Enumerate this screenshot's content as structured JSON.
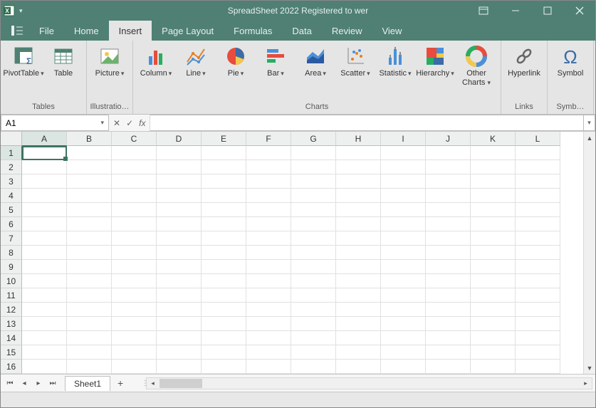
{
  "titlebar": {
    "app_title": "SpreadSheet 2022  Registered to wer"
  },
  "menu": {
    "tabs": [
      "File",
      "Home",
      "Insert",
      "Page Layout",
      "Formulas",
      "Data",
      "Review",
      "View"
    ],
    "active_index": 2
  },
  "ribbon": {
    "groups": [
      {
        "label": "Tables",
        "items": [
          {
            "label": "PivotTable",
            "caret": true
          },
          {
            "label": "Table",
            "caret": false
          }
        ]
      },
      {
        "label": "Illustratio…",
        "items": [
          {
            "label": "Picture",
            "caret": true
          }
        ]
      },
      {
        "label": "Charts",
        "items": [
          {
            "label": "Column",
            "caret": true
          },
          {
            "label": "Line",
            "caret": true
          },
          {
            "label": "Pie",
            "caret": true
          },
          {
            "label": "Bar",
            "caret": true
          },
          {
            "label": "Area",
            "caret": true
          },
          {
            "label": "Scatter",
            "caret": true
          },
          {
            "label": "Statistic",
            "caret": true
          },
          {
            "label": "Hierarchy",
            "caret": true
          },
          {
            "label": "Other Charts",
            "caret": true
          }
        ]
      },
      {
        "label": "Links",
        "items": [
          {
            "label": "Hyperlink",
            "caret": false
          }
        ]
      },
      {
        "label": "Symb…",
        "items": [
          {
            "label": "Symbol",
            "caret": false
          }
        ]
      }
    ]
  },
  "formula_bar": {
    "cell_ref": "A1",
    "formula": ""
  },
  "grid": {
    "columns": [
      "A",
      "B",
      "C",
      "D",
      "E",
      "F",
      "G",
      "H",
      "I",
      "J",
      "K",
      "L"
    ],
    "rows": [
      "1",
      "2",
      "3",
      "4",
      "5",
      "6",
      "7",
      "8",
      "9",
      "10",
      "11",
      "12",
      "13",
      "14",
      "15",
      "16"
    ],
    "selected": {
      "row": 0,
      "col": 0
    }
  },
  "sheet_tabs": {
    "active": "Sheet1",
    "tabs": [
      "Sheet1"
    ]
  }
}
